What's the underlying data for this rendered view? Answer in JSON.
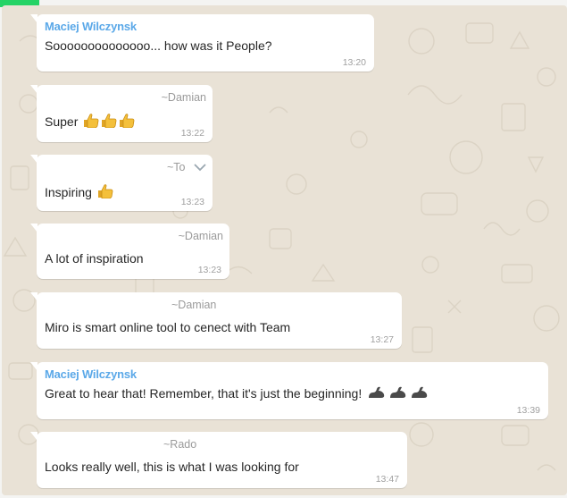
{
  "messages": [
    {
      "author": "Maciej Wilczynsk",
      "text": "Soooooooooooooo... how was it People?",
      "time": "13:20"
    },
    {
      "contact": "~Damian",
      "text": "Super",
      "emoji": [
        "thumbs-up",
        "thumbs-up",
        "thumbs-up"
      ],
      "time": "13:22"
    },
    {
      "contact": "~To",
      "text": "Inspiring",
      "emoji": [
        "thumbs-up"
      ],
      "time": "13:23"
    },
    {
      "contact": "~Damian",
      "text": "A lot of inspiration",
      "time": "13:23"
    },
    {
      "contact": "~Damian",
      "text": "Miro is smart online tool to cenect with Team",
      "time": "13:27"
    },
    {
      "author": "Maciej Wilczynsk",
      "text": "Great to hear that! Remember, that it's just the beginning!",
      "emoji": [
        "flexed-biceps",
        "flexed-biceps",
        "flexed-biceps"
      ],
      "time": "13:39"
    },
    {
      "contact": "~Rado",
      "text": "Looks really well, this is what I was looking for",
      "time": "13:47"
    }
  ],
  "colors": {
    "chat_background": "#e9e2d6",
    "bubble": "#ffffff",
    "author_name": "#5aa8e8",
    "contact_name": "#9b9b9b",
    "timestamp": "#a0a0a0",
    "tab_accent": "#25d366"
  }
}
